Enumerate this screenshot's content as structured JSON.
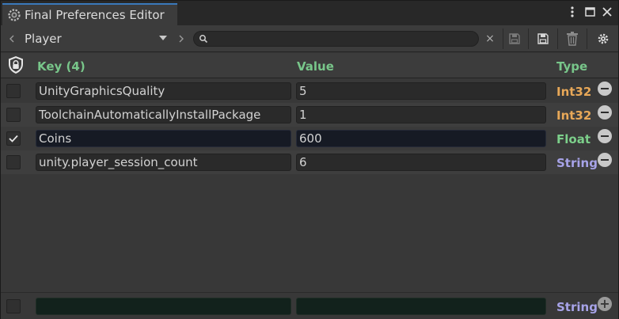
{
  "window": {
    "title": "Final Preferences Editor"
  },
  "toolbar": {
    "source_selected": "Player",
    "search_value": "",
    "clear_symbol": "×"
  },
  "header": {
    "key_label": "Key (4)",
    "value_label": "Value",
    "type_label": "Type"
  },
  "colors": {
    "int32": "#e8a858",
    "float": "#7ccf8a",
    "string": "#a7a3e8",
    "accent": "#3a79bb"
  },
  "rows": [
    {
      "checked": false,
      "key": "UnityGraphicsQuality",
      "value": "5",
      "type": "Int32"
    },
    {
      "checked": false,
      "key": "ToolchainAutomaticallyInstallPackage",
      "value": "1",
      "type": "Int32"
    },
    {
      "checked": true,
      "key": "Coins",
      "value": "600",
      "type": "Float"
    },
    {
      "checked": false,
      "key": "unity.player_session_count",
      "value": "6",
      "type": "String"
    }
  ],
  "new_entry": {
    "key": "",
    "value": "",
    "type": "String"
  }
}
